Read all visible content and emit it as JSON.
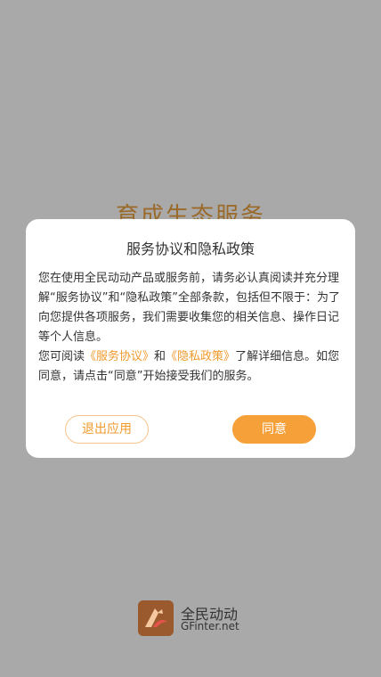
{
  "background": {
    "title": "育成生态服务"
  },
  "dialog": {
    "title": "服务协议和隐私政策",
    "paragraph1": "您在使用全民动动产品或服务前，请务必认真阅读并充分理解“服务协议”和“隐私政策”全部条款，包括但不限于：为了向您提供各项服务，我们需要收集您的相关信息、操作日记等个人信息。",
    "p2_prefix": "您可阅读",
    "service_link": "《服务协议》",
    "p2_and": "和",
    "privacy_link": "《隐私政策》",
    "p2_suffix": "了解详细信息。如您同意，请点击“同意”开始接受我们的服务。",
    "exit_button": "退出应用",
    "agree_button": "同意"
  },
  "brand": {
    "name": "全民动动",
    "url": "GFinter.net",
    "logo_icon": "app-logo-icon",
    "colors": {
      "logo_bg": "#9a5a2e",
      "accent": "#f09a2c"
    }
  }
}
